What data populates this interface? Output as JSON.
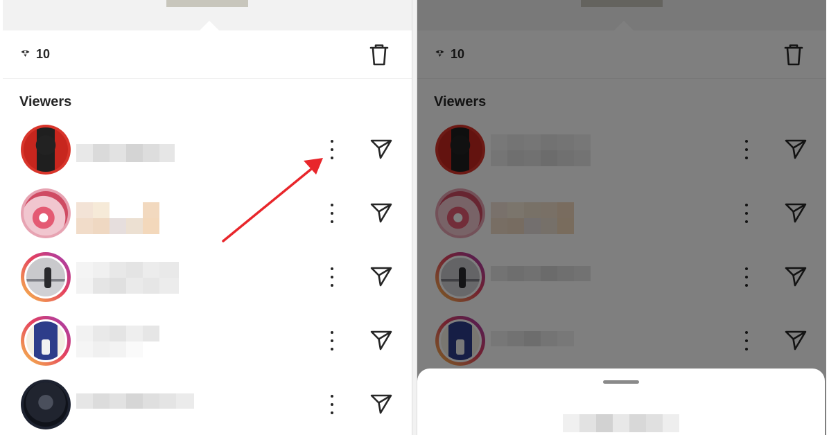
{
  "story_viewers": {
    "view_count": "10",
    "section_title": "Viewers",
    "icons": {
      "views": "eye-icon",
      "delete": "trash-icon",
      "more": "more-options-icon",
      "send": "send-icon"
    },
    "viewer_count_shown": 5
  },
  "annotation": {
    "color": "#e8262b",
    "points_to": "more-options-icon"
  },
  "right_panel": {
    "overlay": "dimmed",
    "bottom_sheet": "open"
  }
}
